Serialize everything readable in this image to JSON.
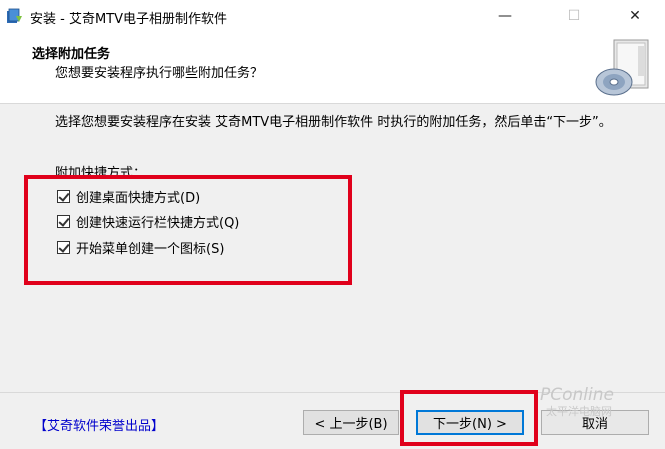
{
  "window": {
    "title": "安装 - 艾奇MTV电子相册制作软件",
    "minimize_glyph": "—",
    "maximize_glyph": "☐",
    "close_glyph": "✕"
  },
  "header": {
    "title": "选择附加任务",
    "subtitle": "您想要安装程序执行哪些附加任务？",
    "image_icon": "installer-disc-icon"
  },
  "main": {
    "description": "选择您想要安装程序在安装 艾奇MTV电子相册制作软件 时执行的附加任务，然后单击“下一步”。",
    "group_label": "附加快捷方式：",
    "tasks": [
      {
        "label": "创建桌面快捷方式(D)",
        "checked": true
      },
      {
        "label": "创建快速运行栏快捷方式(Q)",
        "checked": true
      },
      {
        "label": "开始菜单创建一个图标(S)",
        "checked": true
      }
    ]
  },
  "footer": {
    "brand_link": "【艾奇软件荣誉出品】",
    "back_label": "< 上一步(B)",
    "next_label": "下一步(N) >",
    "cancel_label": "取消"
  },
  "watermark": {
    "text": "PConline",
    "sub": "太平洋电脑网"
  },
  "colors": {
    "highlight_box": "#e0001b",
    "link": "#0000cc",
    "focus_border": "#0078d7"
  }
}
